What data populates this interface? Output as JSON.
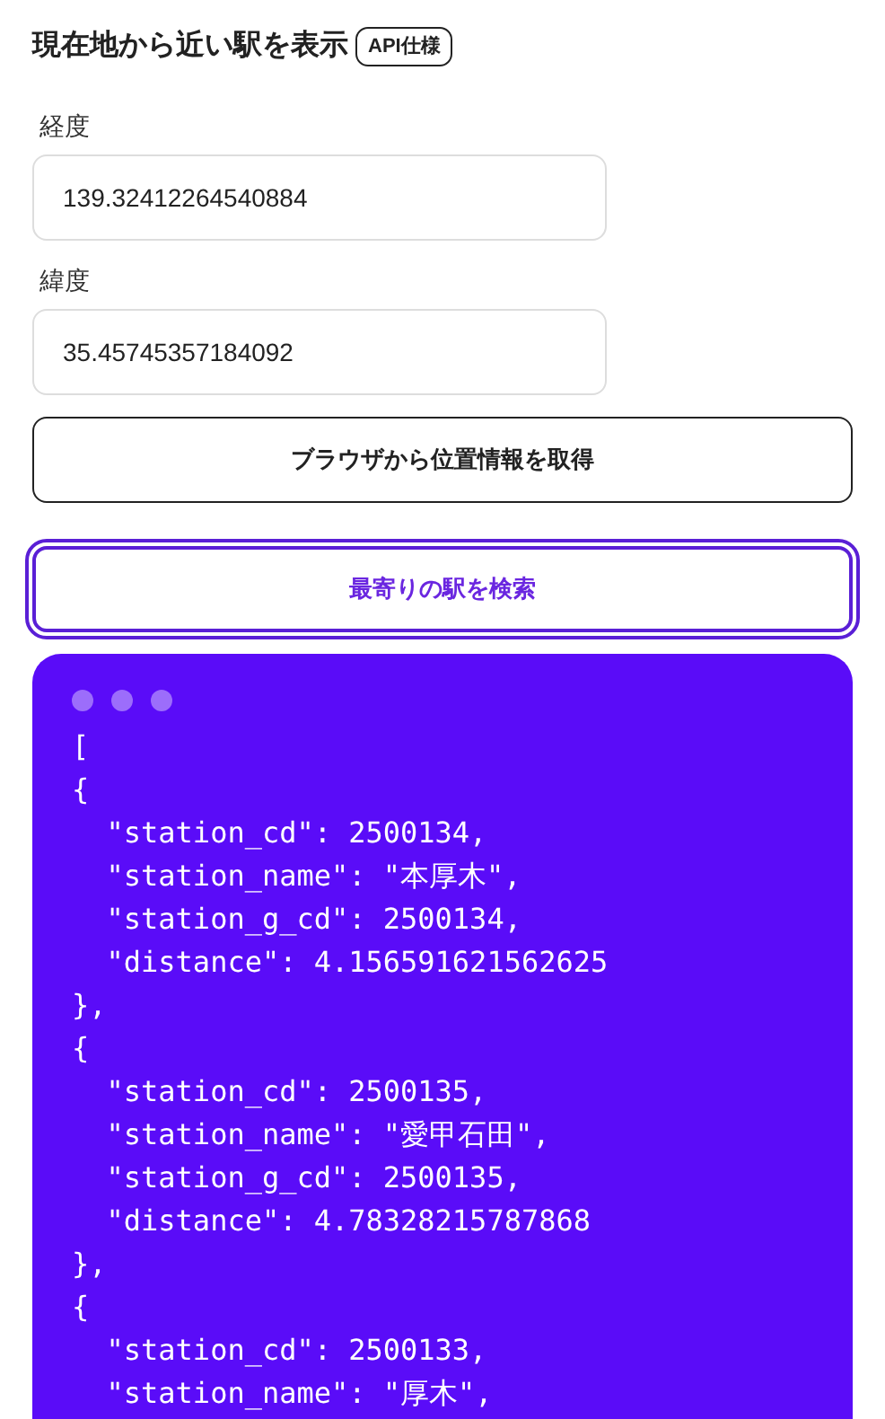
{
  "title": "現在地から近い駅を表示",
  "title_badge": "API仕様",
  "fields": [
    {
      "label": "経度",
      "value": "139.32412264540884"
    },
    {
      "label": "緯度",
      "value": "35.45745357184092"
    }
  ],
  "buttons": [
    {
      "label": "ブラウザから位置情報を取得",
      "kind": "outline",
      "focused": false
    },
    {
      "label": "最寄りの駅を検索",
      "kind": "primary",
      "focused": true
    }
  ],
  "result": {
    "lines": [
      "[",
      "{",
      "  \"station_cd\": 2500134,",
      "  \"station_name\": \"本厚木\",",
      "  \"station_g_cd\": 2500134,",
      "  \"distance\": 4.156591621562625",
      "},",
      "{",
      "  \"station_cd\": 2500135,",
      "  \"station_name\": \"愛甲石田\",",
      "  \"station_g_cd\": 2500135,",
      "  \"distance\": 4.78328215787868",
      "},",
      "{",
      "  \"station_cd\": 2500133,",
      "  \"station_name\": \"厚木\","
    ]
  }
}
